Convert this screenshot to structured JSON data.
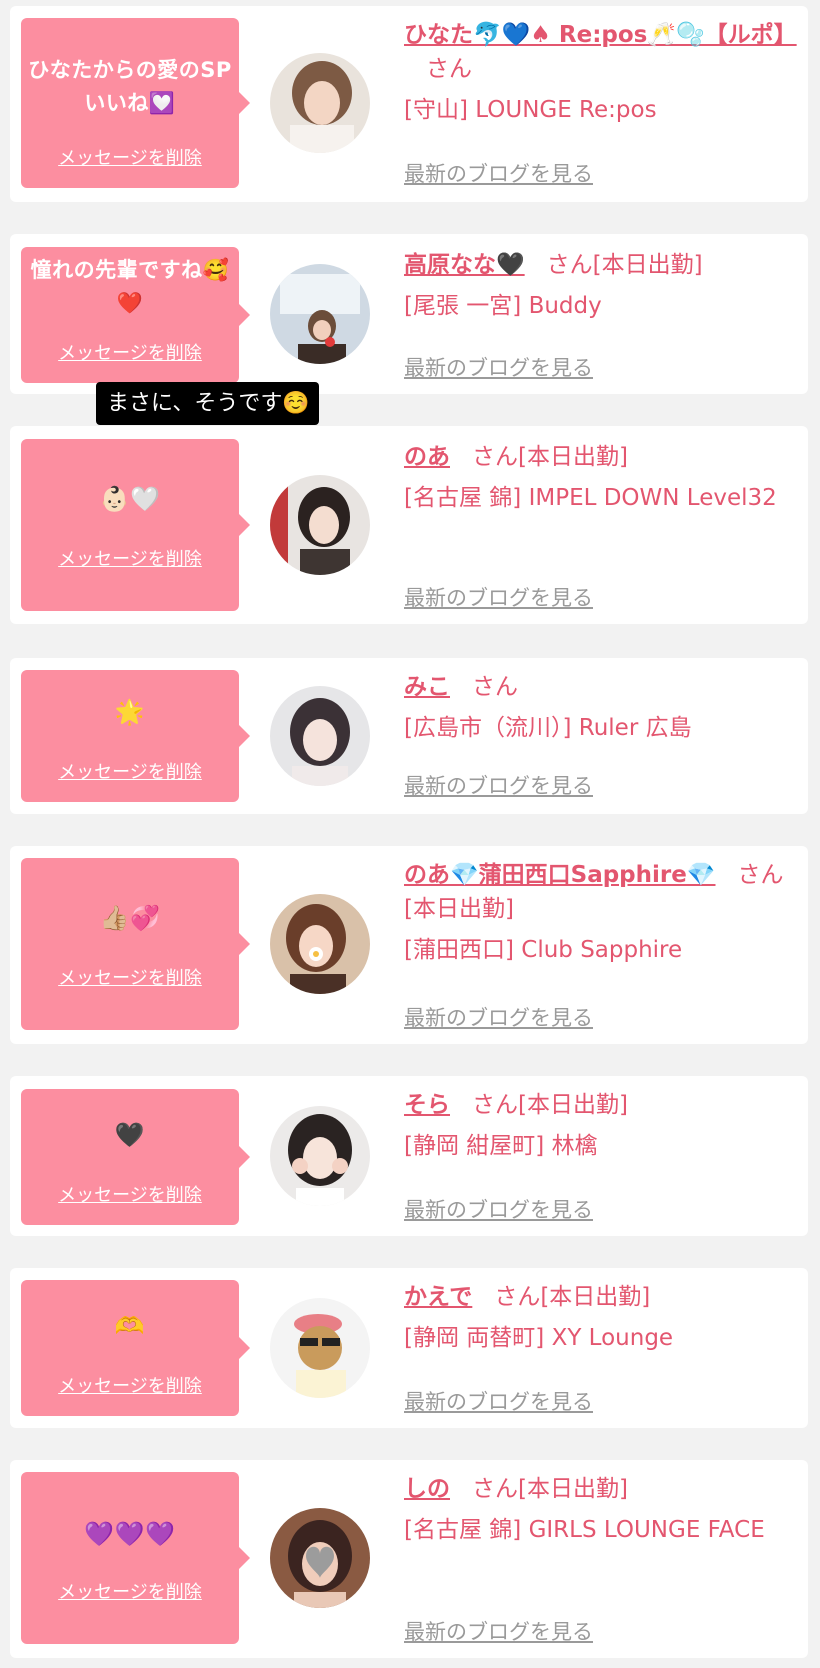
{
  "items": [
    {
      "message": "ひなたからの愛のSPいいね💟",
      "delete_label": "メッセージを削除",
      "name": "ひなた🐬💙♠ Re:pos🥂🫧【ルポ】",
      "san": "さん",
      "working": "",
      "shop": "[守山] LOUNGE Re:pos",
      "blog_label": "最新のブログを見る"
    },
    {
      "message": "憧れの先輩ですね🥰❤️",
      "delete_label": "メッセージを削除",
      "name": "高原なな🖤",
      "san": "さん",
      "working": "[本日出勤]",
      "shop": "[尾張 一宮] Buddy",
      "blog_label": "最新のブログを見る"
    },
    {
      "message": "👶🏻🤍",
      "delete_label": "メッセージを削除",
      "name": "のあ",
      "san": "さん",
      "working": "[本日出勤]",
      "shop": "[名古屋 錦] IMPEL DOWN Level32",
      "blog_label": "最新のブログを見る"
    },
    {
      "message": "🌟",
      "delete_label": "メッセージを削除",
      "name": "みこ",
      "san": "さん",
      "working": "",
      "shop": "[広島市（流川）] Ruler 広島",
      "blog_label": "最新のブログを見る"
    },
    {
      "message": "👍🏼💞",
      "delete_label": "メッセージを削除",
      "name": "のあ💎蒲田西口Sapphire💎",
      "san": "さん",
      "working": "[本日出勤]",
      "shop": "[蒲田西口] Club Sapphire",
      "blog_label": "最新のブログを見る"
    },
    {
      "message": "🖤",
      "delete_label": "メッセージを削除",
      "name": "そら",
      "san": "さん",
      "working": "[本日出勤]",
      "shop": "[静岡 紺屋町] 林檎",
      "blog_label": "最新のブログを見る"
    },
    {
      "message": "🫶",
      "delete_label": "メッセージを削除",
      "name": "かえで",
      "san": "さん",
      "working": "[本日出勤]",
      "shop": "[静岡 両替町] XY Lounge",
      "blog_label": "最新のブログを見る"
    },
    {
      "message": "💜💜💜",
      "delete_label": "メッセージを削除",
      "name": "しの",
      "san": "さん",
      "working": "[本日出勤]",
      "shop": "[名古屋 錦] GIRLS LOUNGE FACE",
      "blog_label": "最新のブログを見る"
    }
  ],
  "tooltip": "まさに、そうです☺️",
  "colors": {
    "background": "#f2f2f2",
    "card": "#ffffff",
    "bubble": "#fc8ea0",
    "accent_text": "#e3566f",
    "link_gray": "#9a9a9a"
  },
  "avatar_icons": [
    "profile-photo-icon",
    "profile-photo-icon",
    "profile-photo-icon",
    "profile-photo-icon",
    "profile-photo-icon",
    "profile-photo-icon",
    "cartoon-avatar-icon",
    "profile-photo-icon"
  ]
}
